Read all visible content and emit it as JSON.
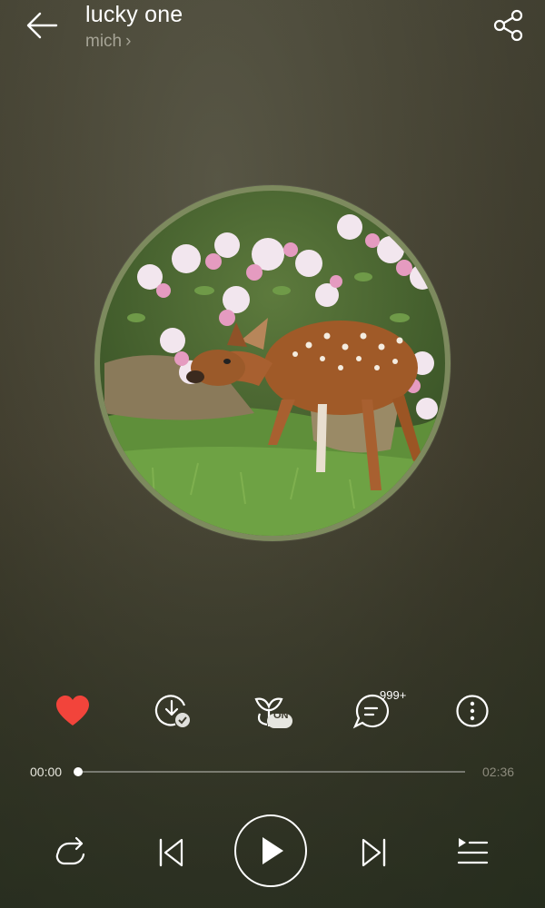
{
  "song": {
    "title": "lucky one",
    "artist": "mich",
    "artist_chevron": "›"
  },
  "actions": {
    "comment_count": "999+",
    "loop_mode_badge": "ON",
    "liked": true
  },
  "playback": {
    "current_time": "00:00",
    "total_time": "02:36",
    "progress": 0
  },
  "colors": {
    "like": "#f2443b",
    "disc_ring": "#7d8a5e"
  },
  "icons": {
    "back": "back-arrow-icon",
    "share": "share-icon",
    "like": "heart-icon",
    "download": "download-icon",
    "ambient": "sound-effect-icon",
    "comments": "comment-icon",
    "more": "more-icon",
    "repeat": "repeat-icon",
    "previous": "previous-icon",
    "play": "play-icon",
    "next": "next-icon",
    "playlist": "playlist-icon"
  }
}
